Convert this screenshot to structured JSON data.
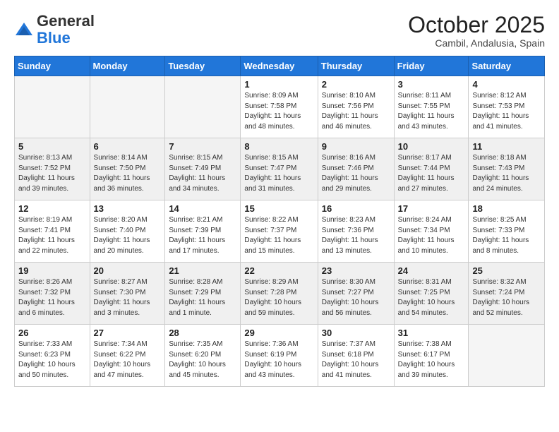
{
  "logo": {
    "general": "General",
    "blue": "Blue"
  },
  "header": {
    "month": "October 2025",
    "location": "Cambil, Andalusia, Spain"
  },
  "weekdays": [
    "Sunday",
    "Monday",
    "Tuesday",
    "Wednesday",
    "Thursday",
    "Friday",
    "Saturday"
  ],
  "weeks": [
    {
      "shaded": false,
      "days": [
        {
          "num": "",
          "info": ""
        },
        {
          "num": "",
          "info": ""
        },
        {
          "num": "",
          "info": ""
        },
        {
          "num": "1",
          "info": "Sunrise: 8:09 AM\nSunset: 7:58 PM\nDaylight: 11 hours\nand 48 minutes."
        },
        {
          "num": "2",
          "info": "Sunrise: 8:10 AM\nSunset: 7:56 PM\nDaylight: 11 hours\nand 46 minutes."
        },
        {
          "num": "3",
          "info": "Sunrise: 8:11 AM\nSunset: 7:55 PM\nDaylight: 11 hours\nand 43 minutes."
        },
        {
          "num": "4",
          "info": "Sunrise: 8:12 AM\nSunset: 7:53 PM\nDaylight: 11 hours\nand 41 minutes."
        }
      ]
    },
    {
      "shaded": true,
      "days": [
        {
          "num": "5",
          "info": "Sunrise: 8:13 AM\nSunset: 7:52 PM\nDaylight: 11 hours\nand 39 minutes."
        },
        {
          "num": "6",
          "info": "Sunrise: 8:14 AM\nSunset: 7:50 PM\nDaylight: 11 hours\nand 36 minutes."
        },
        {
          "num": "7",
          "info": "Sunrise: 8:15 AM\nSunset: 7:49 PM\nDaylight: 11 hours\nand 34 minutes."
        },
        {
          "num": "8",
          "info": "Sunrise: 8:15 AM\nSunset: 7:47 PM\nDaylight: 11 hours\nand 31 minutes."
        },
        {
          "num": "9",
          "info": "Sunrise: 8:16 AM\nSunset: 7:46 PM\nDaylight: 11 hours\nand 29 minutes."
        },
        {
          "num": "10",
          "info": "Sunrise: 8:17 AM\nSunset: 7:44 PM\nDaylight: 11 hours\nand 27 minutes."
        },
        {
          "num": "11",
          "info": "Sunrise: 8:18 AM\nSunset: 7:43 PM\nDaylight: 11 hours\nand 24 minutes."
        }
      ]
    },
    {
      "shaded": false,
      "days": [
        {
          "num": "12",
          "info": "Sunrise: 8:19 AM\nSunset: 7:41 PM\nDaylight: 11 hours\nand 22 minutes."
        },
        {
          "num": "13",
          "info": "Sunrise: 8:20 AM\nSunset: 7:40 PM\nDaylight: 11 hours\nand 20 minutes."
        },
        {
          "num": "14",
          "info": "Sunrise: 8:21 AM\nSunset: 7:39 PM\nDaylight: 11 hours\nand 17 minutes."
        },
        {
          "num": "15",
          "info": "Sunrise: 8:22 AM\nSunset: 7:37 PM\nDaylight: 11 hours\nand 15 minutes."
        },
        {
          "num": "16",
          "info": "Sunrise: 8:23 AM\nSunset: 7:36 PM\nDaylight: 11 hours\nand 13 minutes."
        },
        {
          "num": "17",
          "info": "Sunrise: 8:24 AM\nSunset: 7:34 PM\nDaylight: 11 hours\nand 10 minutes."
        },
        {
          "num": "18",
          "info": "Sunrise: 8:25 AM\nSunset: 7:33 PM\nDaylight: 11 hours\nand 8 minutes."
        }
      ]
    },
    {
      "shaded": true,
      "days": [
        {
          "num": "19",
          "info": "Sunrise: 8:26 AM\nSunset: 7:32 PM\nDaylight: 11 hours\nand 6 minutes."
        },
        {
          "num": "20",
          "info": "Sunrise: 8:27 AM\nSunset: 7:30 PM\nDaylight: 11 hours\nand 3 minutes."
        },
        {
          "num": "21",
          "info": "Sunrise: 8:28 AM\nSunset: 7:29 PM\nDaylight: 11 hours\nand 1 minute."
        },
        {
          "num": "22",
          "info": "Sunrise: 8:29 AM\nSunset: 7:28 PM\nDaylight: 10 hours\nand 59 minutes."
        },
        {
          "num": "23",
          "info": "Sunrise: 8:30 AM\nSunset: 7:27 PM\nDaylight: 10 hours\nand 56 minutes."
        },
        {
          "num": "24",
          "info": "Sunrise: 8:31 AM\nSunset: 7:25 PM\nDaylight: 10 hours\nand 54 minutes."
        },
        {
          "num": "25",
          "info": "Sunrise: 8:32 AM\nSunset: 7:24 PM\nDaylight: 10 hours\nand 52 minutes."
        }
      ]
    },
    {
      "shaded": false,
      "days": [
        {
          "num": "26",
          "info": "Sunrise: 7:33 AM\nSunset: 6:23 PM\nDaylight: 10 hours\nand 50 minutes."
        },
        {
          "num": "27",
          "info": "Sunrise: 7:34 AM\nSunset: 6:22 PM\nDaylight: 10 hours\nand 47 minutes."
        },
        {
          "num": "28",
          "info": "Sunrise: 7:35 AM\nSunset: 6:20 PM\nDaylight: 10 hours\nand 45 minutes."
        },
        {
          "num": "29",
          "info": "Sunrise: 7:36 AM\nSunset: 6:19 PM\nDaylight: 10 hours\nand 43 minutes."
        },
        {
          "num": "30",
          "info": "Sunrise: 7:37 AM\nSunset: 6:18 PM\nDaylight: 10 hours\nand 41 minutes."
        },
        {
          "num": "31",
          "info": "Sunrise: 7:38 AM\nSunset: 6:17 PM\nDaylight: 10 hours\nand 39 minutes."
        },
        {
          "num": "",
          "info": ""
        }
      ]
    }
  ]
}
